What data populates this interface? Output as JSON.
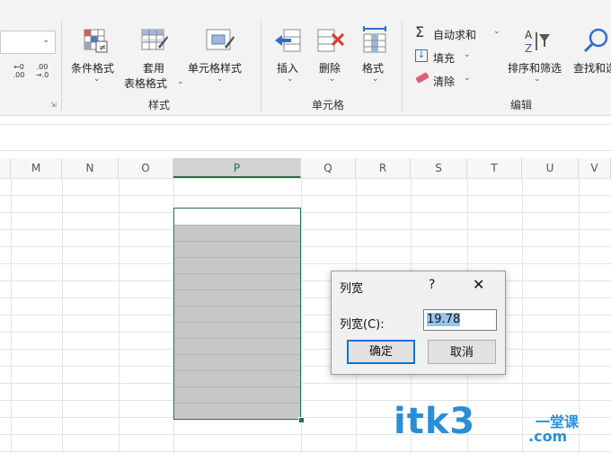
{
  "ribbon": {
    "number_format": {
      "inc_label": ".00 →.0",
      "dec_left": "←0\n.00",
      "dec_right": ".00\n→.0"
    },
    "styles": {
      "conditional_format": "条件格式",
      "table_format_1": "套用",
      "table_format_2": "表格格式",
      "cell_style": "单元格样式",
      "group_label": "样式"
    },
    "cells": {
      "insert": "插入",
      "delete": "删除",
      "format": "格式",
      "group_label": "单元格"
    },
    "editing": {
      "autosum": "自动求和",
      "fill": "填充",
      "clear": "清除",
      "sort_filter": "排序和筛选",
      "find_select": "查找和选",
      "group_label": "编辑"
    }
  },
  "columns": [
    "M",
    "N",
    "O",
    "P",
    "Q",
    "R",
    "S",
    "T",
    "U",
    "V"
  ],
  "selected_column": "P",
  "dialog": {
    "title": "列宽",
    "help": "?",
    "close": "✕",
    "label": "列宽(C):",
    "value": "19.78",
    "ok": "确定",
    "cancel": "取消"
  },
  "watermark": {
    "main": "itk3",
    "cn": "一堂课",
    "dotcom": ".com"
  },
  "colors": {
    "accent": "#217346",
    "dialog_focus": "#0078d7",
    "watermark": "#2a8ed6"
  }
}
